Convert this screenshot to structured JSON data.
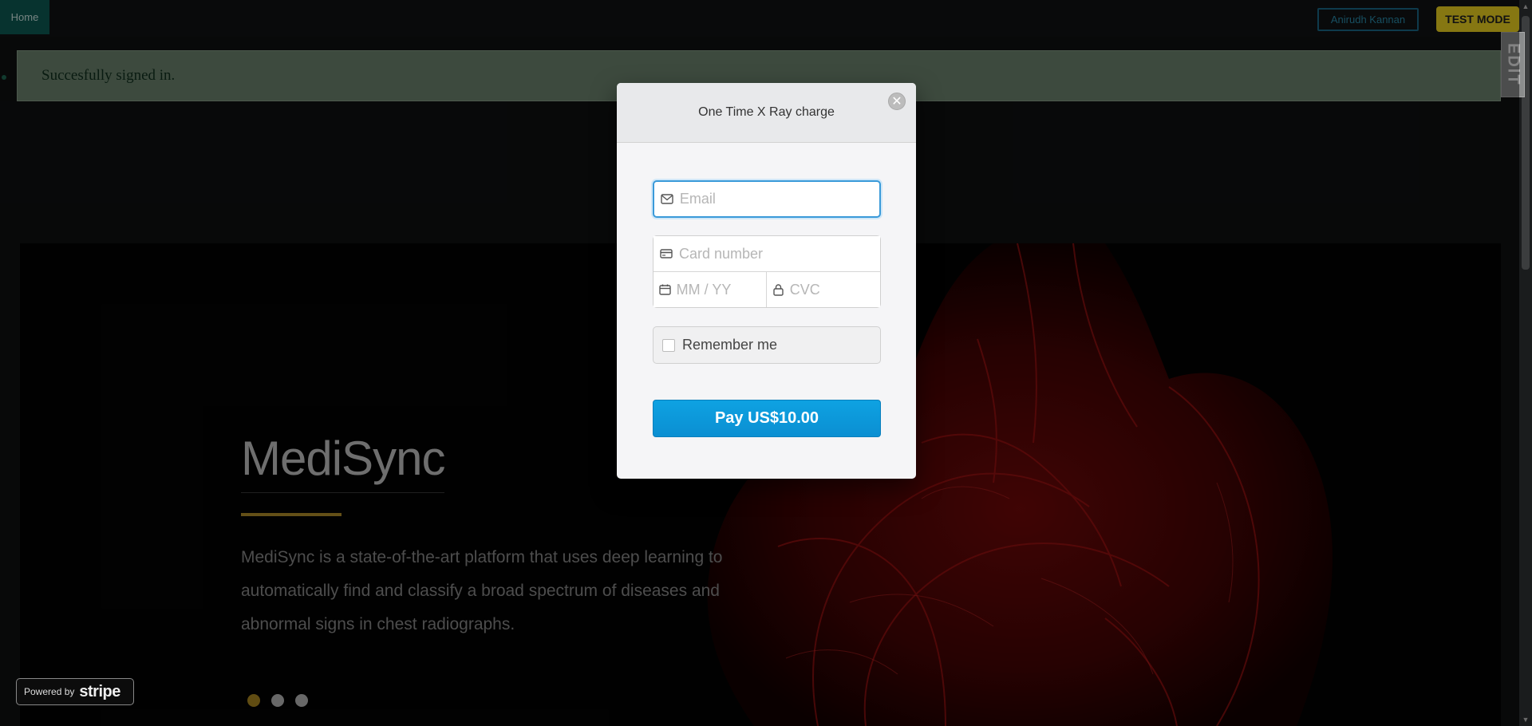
{
  "nav": {
    "home_label": "Home",
    "user_label": "Anirudh Kannan",
    "test_mode_label": "TEST MODE"
  },
  "flash": {
    "message": "Succesfully signed in."
  },
  "side_badge": {
    "text": "EDIT"
  },
  "hero": {
    "title": "MediSync",
    "description": "MediSync is a state-of-the-art platform that uses deep learning to automatically find and classify a broad spectrum of diseases and abnormal signs in chest radiographs.",
    "carousel": {
      "total_slides": 3,
      "active_index": 0
    }
  },
  "powered_by": {
    "prefix": "Powered by",
    "brand": "stripe"
  },
  "checkout": {
    "title": "One Time X Ray charge",
    "email_placeholder": "Email",
    "card_number_placeholder": "Card number",
    "expiry_placeholder": "MM / YY",
    "cvc_placeholder": "CVC",
    "remember_label": "Remember me",
    "pay_label": "Pay US$10.00"
  },
  "colors": {
    "accent_blue": "#0ea2e2",
    "gold": "#b7922a",
    "test_mode": "#f5d922",
    "home_teal": "#0e5e57"
  }
}
